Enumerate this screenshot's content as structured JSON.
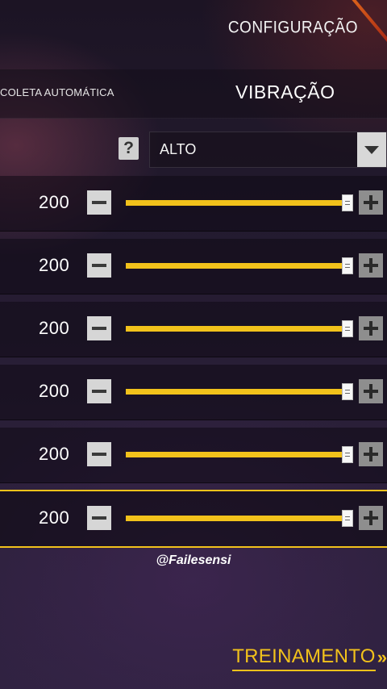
{
  "header": {
    "title": "CONFIGURAÇÃO"
  },
  "tabs": {
    "left_label": "COLETA AUTOMÁTICA",
    "active_label": "VIBRAÇÃO"
  },
  "mode": {
    "help_glyph": "?",
    "selected": "ALTO"
  },
  "sliders": [
    {
      "value": "200",
      "level": 1.0
    },
    {
      "value": "200",
      "level": 1.0
    },
    {
      "value": "200",
      "level": 1.0
    },
    {
      "value": "200",
      "level": 1.0
    },
    {
      "value": "200",
      "level": 1.0
    },
    {
      "value": "200",
      "level": 1.0
    }
  ],
  "watermark": "@Failesensi",
  "footer": {
    "label": "TREINAMENTO",
    "arrow": "»"
  },
  "colors": {
    "accent": "#f2c21b",
    "track": "#555555"
  }
}
